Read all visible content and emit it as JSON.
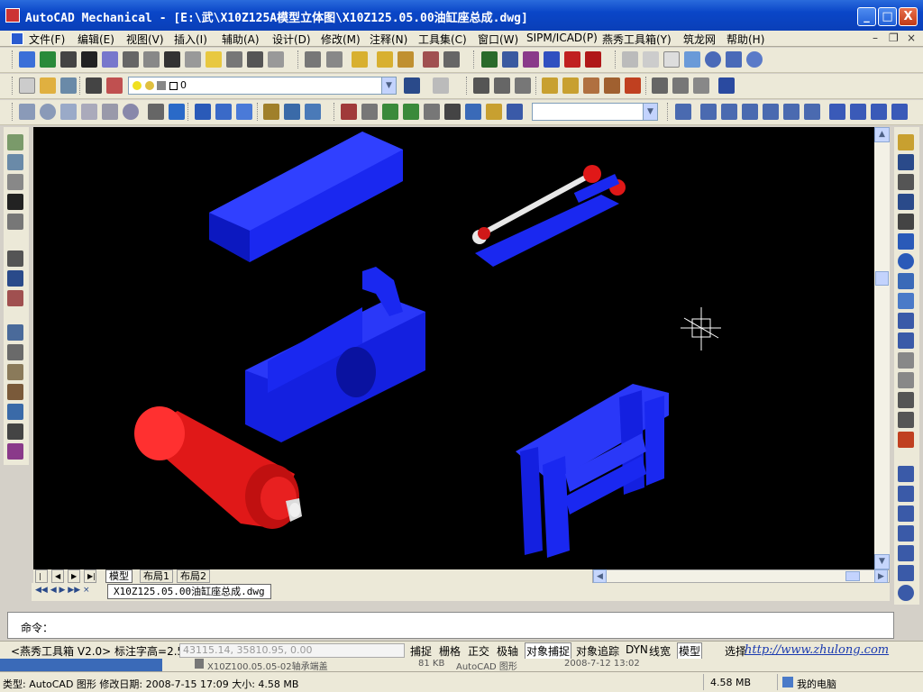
{
  "window": {
    "title": "AutoCAD Mechanical - [E:\\武\\X10Z125A模型立体图\\X10Z125.05.00油缸座总成.dwg]",
    "minimize": "_",
    "maximize": "□",
    "close": "X"
  },
  "menu": {
    "items": [
      "文件(F)",
      "编辑(E)",
      "视图(V)",
      "插入(I)",
      "辅助(A)",
      "设计(D)",
      "修改(M)",
      "注释(N)",
      "工具集(C)",
      "窗口(W)",
      "SIPM/ICAD(P)",
      "燕秀工具箱(Y)",
      "筑龙网",
      "帮助(H)"
    ],
    "doc_minimize": "–",
    "doc_restore": "❐",
    "doc_close": "×"
  },
  "toolbar": {
    "layer_value": "0",
    "style_value": ""
  },
  "tabs": {
    "items": [
      "模型",
      "布局1",
      "布局2"
    ]
  },
  "doc_tab": "X10Z125.05.00油缸座总成.dwg",
  "command": {
    "prompt": "命令："
  },
  "status": {
    "left_label": "<燕秀工具箱 V2.0> 标注字高=2.5",
    "coords": "43115.14, 35810.95, 0.00",
    "buttons": [
      "捕捉",
      "栅格",
      "正交",
      "极轴",
      "对象捕捉",
      "对象追踪",
      "DYN",
      "线宽",
      "模型"
    ],
    "select_label": "选择",
    "website": "http://www.zhulong.com"
  },
  "behind_window": {
    "file_name": "X10Z100.05.05-02轴承端盖",
    "size": "81 KB",
    "type": "AutoCAD 图形",
    "date": "2008-7-12 13:02"
  },
  "explorer_status": {
    "info": "类型: AutoCAD 图形 修改日期: 2008-7-15 17:09 大小: 4.58 MB",
    "size": "4.58 MB",
    "location": "我的电脑"
  },
  "colors": {
    "part_blue": "#1020e8",
    "part_red": "#e01818",
    "title_blue": "#0a46c8"
  }
}
